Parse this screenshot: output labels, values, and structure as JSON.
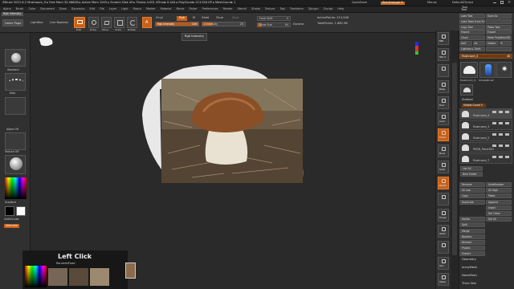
{
  "title": {
    "text": "ZBrush 2021.6.2   Mushroom_9   ▸ Free Mem 32.466GB ▸ Active Mem 1005 ▸ Scratch Disk 49 ▸ Timer▸ 0.001 ATime▸ 0.444 ▸ PolyCount▸ 213.504 KP ▸ MeshCount▸ 1",
    "quicksave": "QuickSave",
    "see_through": "See-through  0",
    "menus": "Menus",
    "default_script": "DefaultZScript"
  },
  "menubar": [
    "Alpha",
    "Brush",
    "Color",
    "Document",
    "Draw",
    "Dynamics",
    "Edit",
    "File",
    "Layer",
    "Light",
    "Macro",
    "Marker",
    "Material",
    "Movie",
    "Picker",
    "Preferences",
    "Render",
    "Stencil",
    "Stroke",
    "Texture",
    "Tool",
    "Transform",
    "Zplugin",
    "Zscript",
    "Help"
  ],
  "toolbar": {
    "rgb_intensity_tab": "Rgb Intensity",
    "home_page": "Home Page",
    "lightbox": "LightBox",
    "live_boolean": "Live Boolean",
    "edit": "Edit",
    "draw": "Draw",
    "move": "Move",
    "scale": "Scale",
    "rotate": "Rotate",
    "a_label": "A",
    "mrgb": "Mrgb",
    "rgb": "Rgb",
    "m": "M",
    "zadd": "Zadd",
    "zsub": "Zsub",
    "zcut": "Zcut",
    "rgb_intensity_slider": "Rgb Intensity",
    "rgb_intensity_value": "100",
    "z_intensity": "Z Intensity",
    "z_intensity_value": "25",
    "focal_shift": "Focal Shift",
    "focal_shift_value": "0",
    "draw_size": "Draw Size",
    "draw_size_value": "64",
    "dynamic": "Dynamic",
    "active_points": "ActivePoints: 213,506",
    "total_points": "TotalPoints: 1.880 Mil",
    "tooltip": "Rgb Intensity"
  },
  "left_shelf": {
    "brush_label": "Standard",
    "stroke_label": "Dots",
    "alpha_label": "Alpha Off",
    "texture_label": "Texture Off",
    "material_label": "",
    "gradient": "Gradient",
    "switch_color": "SwitchColor",
    "alternate": "Alternate"
  },
  "canvas": {
    "left_click": "Left Click",
    "shortcut_hint": "RandomiFiash"
  },
  "right_shelf": [
    "BPR",
    "SPix 3",
    "",
    "Persp",
    "Floor",
    "Local",
    "Frame",
    "Move",
    "Scale",
    "Rotate",
    "",
    "Transp",
    "Ghost",
    "",
    "Solo",
    "Xpose"
  ],
  "tray": {
    "tool_label": "Tool",
    "buttons": [
      [
        "Load Tool",
        "Save As"
      ],
      [
        "Load Tools From Project",
        ""
      ],
      [
        "Copy Tool",
        "Paste Tool"
      ],
      [
        "Import",
        "Export"
      ],
      [
        "Clone",
        "Make PolyMesh3D"
      ],
      [
        "GoZ",
        "All",
        "Visible",
        "R"
      ],
      [
        "Lightbox ▸ Tools",
        ""
      ]
    ],
    "current_tool": "Mushroom_4",
    "current_tool_value": "48",
    "tool_thumbs": [
      "Mushroom_4",
      "Cylinder3D",
      "PolyMesh3D",
      "SimpleBrush",
      "EraserB",
      "Mushro"
    ],
    "subtool_header": "Subtool",
    "visible_count": "Visible Count 5",
    "subtools": [
      "Mushroom_4",
      "Mushroom_3",
      "Mushroom_5",
      "PM3D_Plane3D1",
      "Mushroom_7"
    ],
    "list_all": "List All",
    "new_folder": "New Folder",
    "rows": [
      [
        "Rename",
        "AutoReorder"
      ],
      [
        "All Low",
        "All High"
      ],
      [
        "Copy",
        "Paste"
      ],
      [
        "Duplicate",
        "Append"
      ],
      [
        "",
        "Insert"
      ],
      [
        "",
        "Del Other"
      ],
      [
        "Delete",
        "Del All"
      ],
      [
        "Split",
        ""
      ],
      [
        "Merge",
        ""
      ],
      [
        "Boolean",
        ""
      ],
      [
        "Remesh",
        ""
      ],
      [
        "Project",
        ""
      ],
      [
        "Extract",
        ""
      ]
    ],
    "bottom_items": [
      "Geometry",
      "ArrayMesh",
      "NanoMesh",
      "Thick Skin",
      "Layers"
    ]
  }
}
